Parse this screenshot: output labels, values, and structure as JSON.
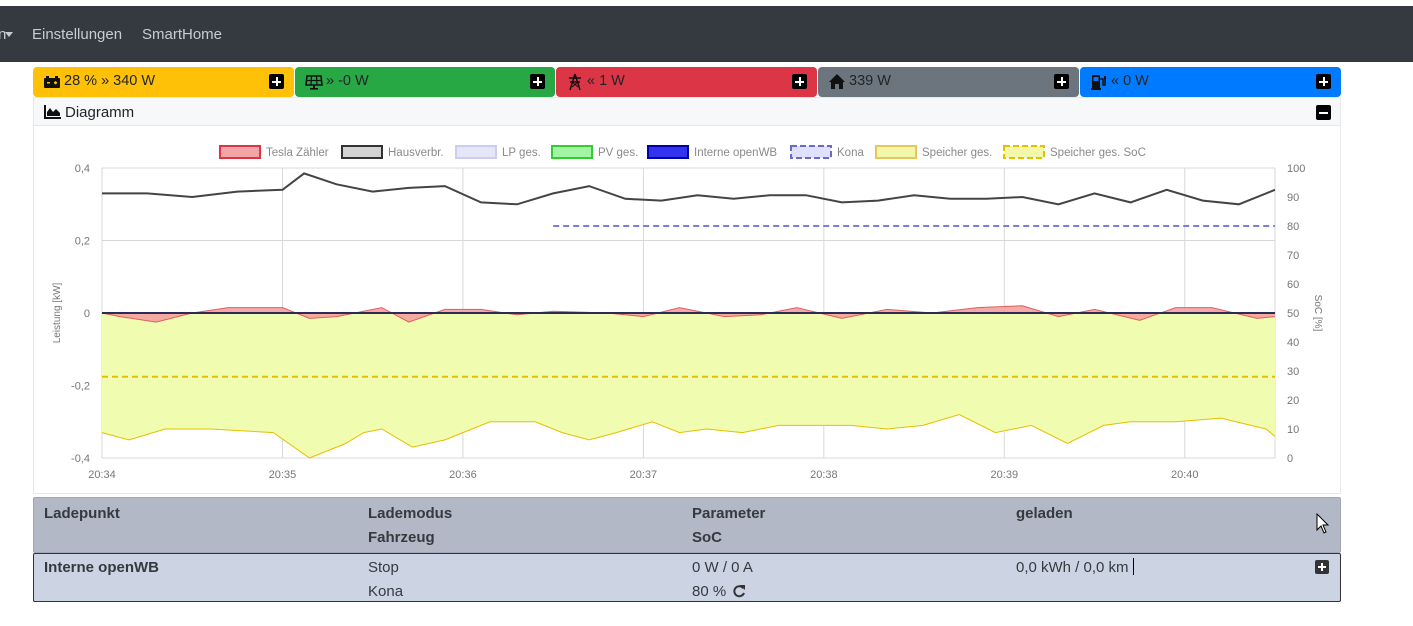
{
  "nav": {
    "items": [
      {
        "label": "n",
        "dropdown": true
      },
      {
        "label": "Einstellungen"
      },
      {
        "label": "SmartHome"
      }
    ]
  },
  "status_cards": [
    {
      "icon": "battery-car-icon",
      "text": "28 % » 340 W",
      "color": "#ffc107"
    },
    {
      "icon": "solar-panel-icon",
      "text": "» -0 W",
      "color": "#28a745"
    },
    {
      "icon": "power-tower-icon",
      "text": "« 1 W",
      "color": "#dc3545"
    },
    {
      "icon": "home-icon",
      "text": "339 W",
      "color": "#6c757d"
    },
    {
      "icon": "charging-station-icon",
      "text": "« 0 W",
      "color": "#007bff"
    }
  ],
  "diagram": {
    "title": "Diagramm"
  },
  "chart_data": {
    "type": "area",
    "title": "",
    "xlabel": "",
    "ylabel": "Leistung [kW]",
    "y2label": "SoC [%]",
    "ylim": [
      -0.4,
      0.4
    ],
    "y2lim": [
      0,
      100
    ],
    "yticks": [
      "0,4",
      "0,2",
      "0",
      "-0,2",
      "-0,4"
    ],
    "y2ticks": [
      "100",
      "90",
      "80",
      "70",
      "60",
      "50",
      "40",
      "30",
      "20",
      "10",
      "0"
    ],
    "xticks": [
      "20:34",
      "20:35",
      "20:36",
      "20:37",
      "20:38",
      "20:39",
      "20:40"
    ],
    "xlim": [
      "20:34",
      "20:40:30"
    ],
    "grid": true,
    "legend_position": "top",
    "legend": [
      {
        "name": "Tesla Zähler",
        "fill": "#f4a6a6",
        "stroke": "#dc3545",
        "dashed": false
      },
      {
        "name": "Hausverbr.",
        "fill": "#d3d3d3",
        "stroke": "#333333",
        "dashed": false
      },
      {
        "name": "LP ges.",
        "fill": "#e6e6fa",
        "stroke": "#ccccee",
        "dashed": false
      },
      {
        "name": "PV ges.",
        "fill": "#a3f5a3",
        "stroke": "#32cd32",
        "dashed": false
      },
      {
        "name": "Interne openWB",
        "fill": "#3333ee",
        "stroke": "#0000aa",
        "dashed": false
      },
      {
        "name": "Kona",
        "fill": "#e0e0ff",
        "stroke": "#6a6acd",
        "dashed": true
      },
      {
        "name": "Speicher ges.",
        "fill": "#f2f7a9",
        "stroke": "#e6c85a",
        "dashed": false
      },
      {
        "name": "Speicher ges. SoC",
        "fill": "#f2f7a9",
        "stroke": "#e6c000",
        "dashed": true
      }
    ],
    "series": [
      {
        "name": "Hausverbr.",
        "axis": "left",
        "color": "#444444",
        "x": [
          0,
          0.25,
          0.5,
          0.75,
          1,
          1.12,
          1.3,
          1.5,
          1.7,
          1.9,
          2.1,
          2.3,
          2.5,
          2.7,
          2.9,
          3.1,
          3.3,
          3.5,
          3.7,
          3.9,
          4.1,
          4.3,
          4.5,
          4.7,
          4.9,
          5.1,
          5.3,
          5.5,
          5.7,
          5.9,
          6.1,
          6.3,
          6.5
        ],
        "y": [
          0.33,
          0.33,
          0.32,
          0.335,
          0.34,
          0.385,
          0.355,
          0.335,
          0.345,
          0.35,
          0.305,
          0.3,
          0.33,
          0.35,
          0.315,
          0.31,
          0.325,
          0.315,
          0.325,
          0.325,
          0.305,
          0.31,
          0.325,
          0.315,
          0.315,
          0.32,
          0.3,
          0.33,
          0.305,
          0.34,
          0.31,
          0.3,
          0.34
        ]
      },
      {
        "name": "Tesla Zähler",
        "axis": "left",
        "color": "#e06060",
        "x": [
          0,
          0.1,
          0.3,
          0.5,
          0.7,
          0.85,
          1,
          1.15,
          1.3,
          1.55,
          1.7,
          1.9,
          2.1,
          2.3,
          2.5,
          2.8,
          3,
          3.2,
          3.45,
          3.65,
          3.85,
          4.1,
          4.35,
          4.6,
          4.85,
          5.1,
          5.3,
          5.5,
          5.75,
          5.95,
          6.15,
          6.4,
          6.6
        ],
        "y": [
          0,
          -0.01,
          -0.025,
          0,
          0.015,
          0.015,
          0.015,
          -0.015,
          -0.01,
          0.015,
          -0.025,
          0.01,
          0.01,
          -0.005,
          0.005,
          0,
          -0.01,
          0.015,
          -0.01,
          -0.005,
          0.015,
          -0.015,
          0.01,
          0,
          0.015,
          0.02,
          -0.01,
          0.01,
          -0.02,
          0.015,
          0.015,
          -0.015,
          -0.01
        ]
      },
      {
        "name": "Interne openWB",
        "axis": "left",
        "color": "#222266",
        "x": [
          0,
          6.6
        ],
        "y": [
          0,
          0
        ]
      },
      {
        "name": "Speicher ges.",
        "axis": "left",
        "color": "#e6c000",
        "x": [
          0,
          0.15,
          0.35,
          0.6,
          0.95,
          1.15,
          1.35,
          1.45,
          1.55,
          1.72,
          1.9,
          2.0,
          2.15,
          2.4,
          2.55,
          2.7,
          2.85,
          3.05,
          3.2,
          3.35,
          3.55,
          3.75,
          3.95,
          4.15,
          4.35,
          4.55,
          4.75,
          4.95,
          5.15,
          5.35,
          5.55,
          5.7,
          5.95,
          6.2,
          6.45,
          6.6
        ],
        "y": [
          -0.33,
          -0.35,
          -0.32,
          -0.32,
          -0.33,
          -0.4,
          -0.36,
          -0.33,
          -0.32,
          -0.37,
          -0.35,
          -0.33,
          -0.3,
          -0.3,
          -0.33,
          -0.35,
          -0.33,
          -0.3,
          -0.33,
          -0.32,
          -0.33,
          -0.31,
          -0.31,
          -0.31,
          -0.32,
          -0.31,
          -0.28,
          -0.33,
          -0.31,
          -0.36,
          -0.31,
          -0.3,
          -0.3,
          -0.29,
          -0.32,
          -0.34
        ]
      },
      {
        "name": "Kona",
        "axis": "right",
        "color": "#7b7be0",
        "dashed": true,
        "x": [
          2.5,
          6.6
        ],
        "y": [
          80,
          80
        ]
      },
      {
        "name": "Speicher ges. SoC",
        "axis": "right",
        "color": "#e6c000",
        "dashed": true,
        "x": [
          0,
          6.6
        ],
        "y": [
          28,
          28
        ]
      }
    ]
  },
  "table": {
    "headers": {
      "ladepunkt": "Ladepunkt",
      "lademodus": "Lademodus",
      "fahrzeug": "Fahrzeug",
      "parameter": "Parameter",
      "soc": "SoC",
      "geladen": "geladen"
    },
    "rows": [
      {
        "ladepunkt": "Interne openWB",
        "lademodus": "Stop",
        "fahrzeug": "Kona",
        "parameter": "0 W / 0 A",
        "soc": "80 %",
        "geladen": "0,0 kWh / 0,0 km"
      }
    ]
  }
}
